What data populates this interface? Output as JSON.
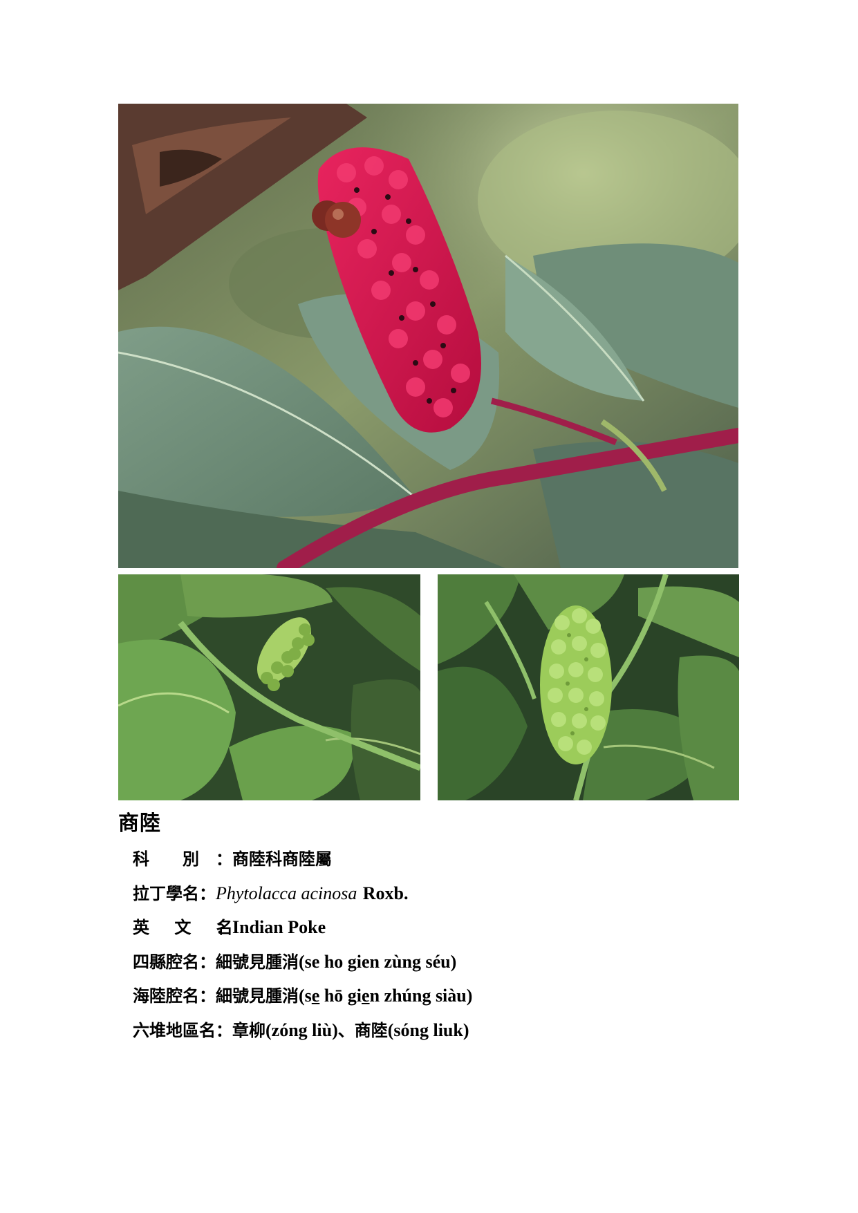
{
  "species": {
    "name": "商陸",
    "rows": [
      {
        "key": "family",
        "label": "科　　別",
        "value": "商陸科商陸屬"
      },
      {
        "key": "latin",
        "label": "拉丁學名",
        "genus_species": "Phytolacca acinosa",
        "author": "Roxb."
      },
      {
        "key": "english",
        "label": "英 文 名",
        "value": "Indian Poke"
      },
      {
        "key": "sixian",
        "label": "四縣腔名",
        "han": "細號見腫消",
        "romanization": "(se ho gien zùng séu)"
      },
      {
        "key": "hailu",
        "label": "海陸腔名",
        "han": "細號見腫消",
        "rom_parts": [
          "(s",
          "e",
          " hō gi",
          "e",
          "n zhúng siàu)"
        ]
      },
      {
        "key": "liudui",
        "label": "六堆地區名",
        "parts": [
          "章柳",
          "(zóng liù)",
          "、",
          "商陸",
          "(sóng liuk)"
        ]
      }
    ],
    "colon": "："
  },
  "photos": {
    "main": "pokeweed-red-flower-spike",
    "left": "pokeweed-green-berries-left",
    "right": "pokeweed-green-berries-right"
  },
  "colors": {
    "flower": "#d4144c",
    "stem": "#a01e4a",
    "leaf": "#6f8f78",
    "berry": "#9ccc5a"
  }
}
